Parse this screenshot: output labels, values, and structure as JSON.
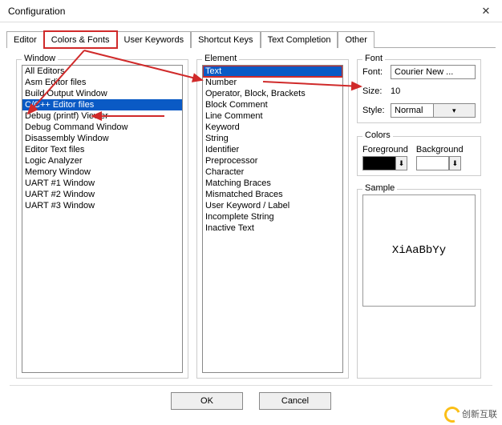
{
  "window": {
    "title": "Configuration"
  },
  "tabs": {
    "items": [
      {
        "label": "Editor"
      },
      {
        "label": "Colors & Fonts"
      },
      {
        "label": "User Keywords"
      },
      {
        "label": "Shortcut Keys"
      },
      {
        "label": "Text Completion"
      },
      {
        "label": "Other"
      }
    ]
  },
  "panels": {
    "window_list": {
      "legend": "Window",
      "items": [
        "All Editors",
        "Asm Editor files",
        "Build Output Window",
        "C/C++ Editor files",
        "Debug (printf) Viewer",
        "Debug Command Window",
        "Disassembly Window",
        "Editor Text files",
        "Logic Analyzer",
        "Memory Window",
        "UART #1 Window",
        "UART #2 Window",
        "UART #3 Window"
      ],
      "selected_index": 3
    },
    "element_list": {
      "legend": "Element",
      "items": [
        "Text",
        "Number",
        "Operator, Block, Brackets",
        "Block Comment",
        "Line Comment",
        "Keyword",
        "String",
        "Identifier",
        "Preprocessor",
        "Character",
        "Matching Braces",
        "Mismatched Braces",
        "User Keyword / Label",
        "Incomplete String",
        "Inactive Text"
      ],
      "selected_index": 0
    },
    "font": {
      "legend": "Font",
      "font_label": "Font:",
      "font_value": "Courier New ...",
      "size_label": "Size:",
      "size_value": "10",
      "style_label": "Style:",
      "style_value": "Normal"
    },
    "colors": {
      "legend": "Colors",
      "fg_label": "Foreground",
      "bg_label": "Background",
      "fg_hex": "#000000",
      "bg_hex": "#FFFFFF"
    },
    "sample": {
      "legend": "Sample",
      "text": "XiAaBbYy"
    }
  },
  "buttons": {
    "ok": "OK",
    "cancel": "Cancel"
  },
  "watermark": "创新互联"
}
